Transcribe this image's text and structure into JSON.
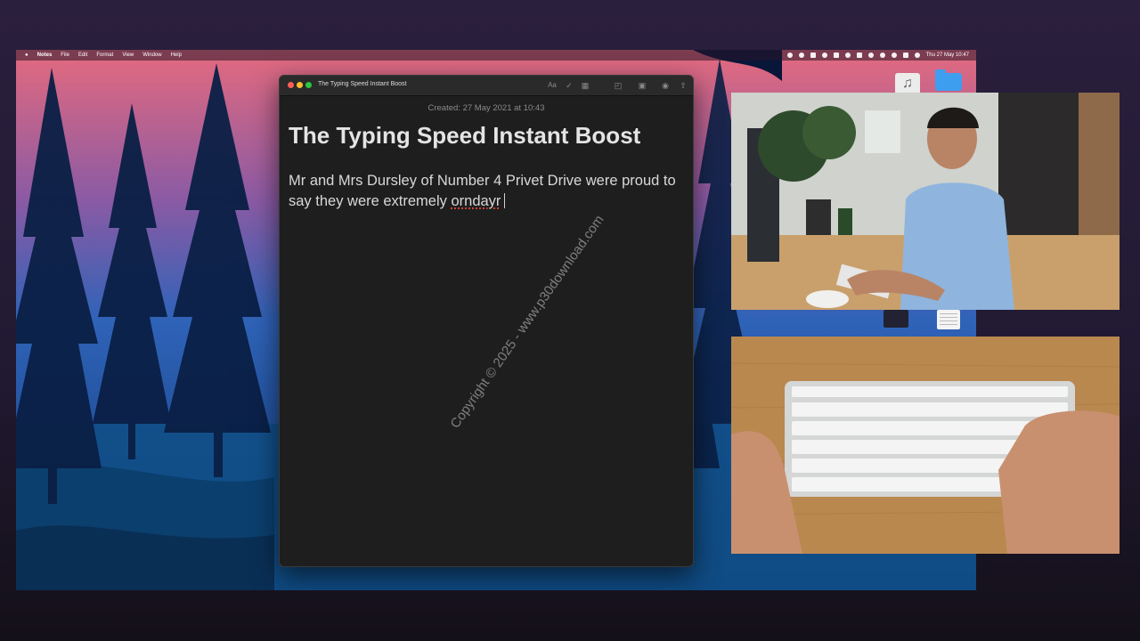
{
  "menubar": {
    "apple_icon": "apple-icon",
    "app_name": "Notes",
    "items": [
      "File",
      "Edit",
      "Format",
      "View",
      "Window",
      "Help"
    ],
    "clock": "Thu 27 May  10:47"
  },
  "notes_window": {
    "title": "The Typing Speed Instant Boost",
    "toolbar": {
      "format_label": "Aa",
      "icons": [
        "checklist-icon",
        "table-icon",
        "lock-icon",
        "media-icon",
        "collaborate-icon",
        "share-icon"
      ]
    },
    "created": "Created: 27 May 2021 at 10:43",
    "note_title": "The Typing Speed Instant Boost",
    "body_text": "Mr and Mrs Dursley of Number 4 Privet Drive were proud to say they were extremely ",
    "misspelled_word": "orndayr"
  },
  "watermark": "Copyright © 2025 - www.p30download.com",
  "desktop_icons": [
    "music-icon",
    "folder-icon",
    "image-file-icon",
    "document-icon"
  ],
  "colors": {
    "close": "#ff5f57",
    "minimize": "#febc2e",
    "maximize": "#28c840",
    "note_background": "#1e1e1e",
    "spelling_underline": "#e24a3a"
  }
}
